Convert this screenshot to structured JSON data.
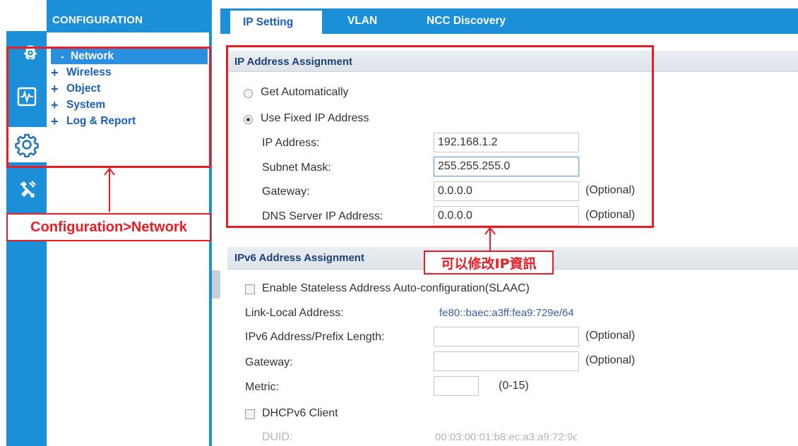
{
  "sidebar": {
    "title": "CONFIGURATION",
    "rail_icons": [
      "monitor-icon",
      "dashboard-icon",
      "gear-icon",
      "maintenance-icon"
    ],
    "menu": [
      {
        "symbol": "-",
        "label": "Network",
        "active": true
      },
      {
        "symbol": "+",
        "label": "Wireless",
        "active": false
      },
      {
        "symbol": "+",
        "label": "Object",
        "active": false
      },
      {
        "symbol": "+",
        "label": "System",
        "active": false
      },
      {
        "symbol": "+",
        "label": "Log & Report",
        "active": false
      }
    ]
  },
  "tabs": [
    {
      "label": "IP Setting",
      "active": true
    },
    {
      "label": "VLAN",
      "active": false
    },
    {
      "label": "NCC Discovery",
      "active": false
    }
  ],
  "ipv4": {
    "title": "IP Address Assignment",
    "get_auto_label": "Get Automatically",
    "fixed_label": "Use Fixed IP Address",
    "ip_label": "IP Address:",
    "ip_value": "192.168.1.2",
    "subnet_label": "Subnet Mask:",
    "subnet_value": "255.255.255.0",
    "gateway_label": "Gateway:",
    "gateway_value": "0.0.0.0",
    "gateway_optional": "(Optional)",
    "dns_label": "DNS Server IP Address:",
    "dns_value": "0.0.0.0",
    "dns_optional": "(Optional)"
  },
  "ipv6": {
    "title": "IPv6 Address Assignment",
    "slaac_label": "Enable Stateless Address Auto-configuration(SLAAC)",
    "link_local_label": "Link-Local Address:",
    "link_local_value": "fe80::baec:a3ff:fea9:729e/64",
    "prefix_label": "IPv6 Address/Prefix Length:",
    "prefix_value": "",
    "prefix_optional": "(Optional)",
    "gateway_label": "Gateway:",
    "gateway_value": "",
    "gateway_optional": "(Optional)",
    "metric_label": "Metric:",
    "metric_value": "",
    "metric_range": "(0-15)",
    "dhcpv6_label": "DHCPv6 Client",
    "duid_label": "DUID:",
    "duid_value": "00:03:00:01:b8:ec:a3:a9:72:9ϵ"
  },
  "annotations": {
    "path_label": "Configuration>Network",
    "modify_label": "可以修改IP資訊",
    "color": "#ea1c24"
  },
  "colors": {
    "primary_blue": "#1b8fd8",
    "menu_text": "#1b5fbd",
    "section_title": "#1d3f75"
  }
}
